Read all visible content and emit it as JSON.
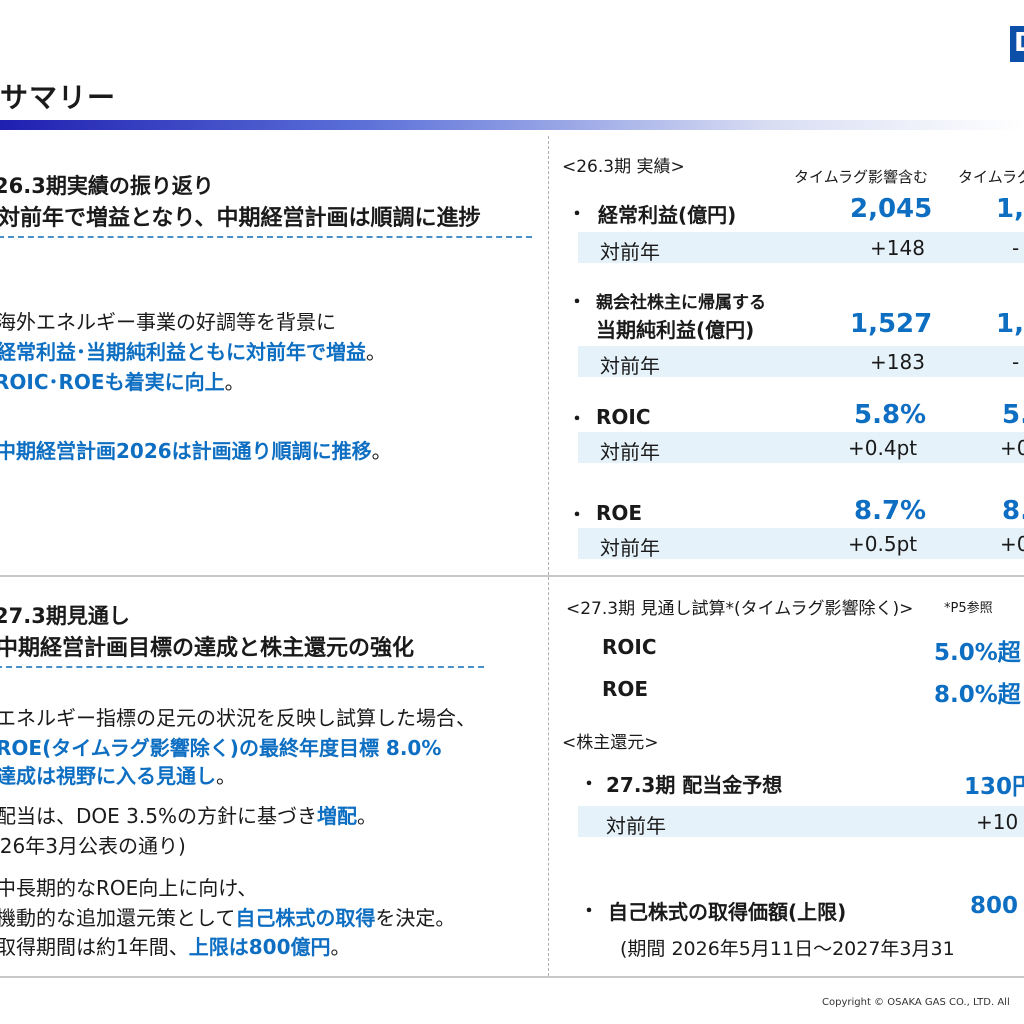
{
  "header": {
    "title": "サマリー",
    "logo_text": "D"
  },
  "left_top": {
    "heading": "26.3期実績の振り返り",
    "subheading": "対前年で増益となり、中期経営計画は順調に進捗",
    "line1": "海外エネルギー事業の好調等を背景に",
    "line2": "経常利益･当期純利益ともに対前年で増益",
    "line2_suffix": "。",
    "line3": "ROIC･ROEも着実に向上",
    "line3_suffix": "。",
    "line4": "中期経営計画2026は計画通り順調に推移",
    "line4_suffix": "。"
  },
  "left_bottom": {
    "heading": "27.3期見通し",
    "subheading": "中期経営計画目標の達成と株主還元の強化",
    "line1": "エネルギー指標の足元の状況を反映し試算した場合、",
    "line2": "ROE(タイムラグ影響除く)の最終年度目標 8.0%",
    "line3": "達成は視野に入る見通し",
    "line3_suffix": "。",
    "line4_prefix": "配当は、DOE 3.5%の方針に基づき",
    "line4_blue": "増配",
    "line4_suffix": "。",
    "line5": "(26年3月公表の通り)",
    "line6": "中長期的なROE向上に向け、",
    "line7_prefix": "機動的な追加還元策として",
    "line7_blue": "自己株式の取得",
    "line7_suffix": "を決定。",
    "line8_prefix": "取得期間は約1年間、",
    "line8_blue": "上限は800億円",
    "line8_suffix": "。"
  },
  "right_top": {
    "section_label": "<26.3期 実績>",
    "col1_header": "タイムラグ影響含む",
    "col2_header": "タイムラグ",
    "bullet": "・",
    "rows": [
      {
        "label": "経常利益(億円)",
        "value1": "2,045",
        "value2": "1,",
        "yoy_label": "対前年",
        "yoy1": "+148",
        "yoy2": "-"
      },
      {
        "label_line1": "親会社株主に帰属する",
        "label": "当期純利益(億円)",
        "value1": "1,527",
        "value2": "1,",
        "yoy_label": "対前年",
        "yoy1": "+183",
        "yoy2": "-"
      },
      {
        "label": "ROIC",
        "value1": "5.8%",
        "value2": "5.",
        "yoy_label": "対前年",
        "yoy1": "+0.4pt",
        "yoy2": "+0"
      },
      {
        "label": "ROE",
        "value1": "8.7%",
        "value2": "8.",
        "yoy_label": "対前年",
        "yoy1": "+0.5pt",
        "yoy2": "+0"
      }
    ]
  },
  "right_bottom": {
    "section_label": "<27.3期 見通し試算*(タイムラグ影響除く)>",
    "note": "*P5参照",
    "roic_label": "ROIC",
    "roic_value": "5.0%超",
    "roe_label": "ROE",
    "roe_value": "8.0%超",
    "return_label": "<株主還元>",
    "dividend_label": "27.3期 配当金予想",
    "dividend_value": "130円",
    "dividend_yoy_label": "対前年",
    "dividend_yoy": "+10",
    "buyback_label": "自己株式の取得価額(上限)",
    "buyback_value": "800",
    "period": "(期間  2026年5月11日～2027年3月31"
  },
  "footer": {
    "copyright": "Copyright © OSAKA GAS CO., LTD. All"
  },
  "colors": {
    "accent_blue": "#0e6fc2",
    "band": "#e6f2fa",
    "title_bar_start": "#1f1fb0"
  }
}
